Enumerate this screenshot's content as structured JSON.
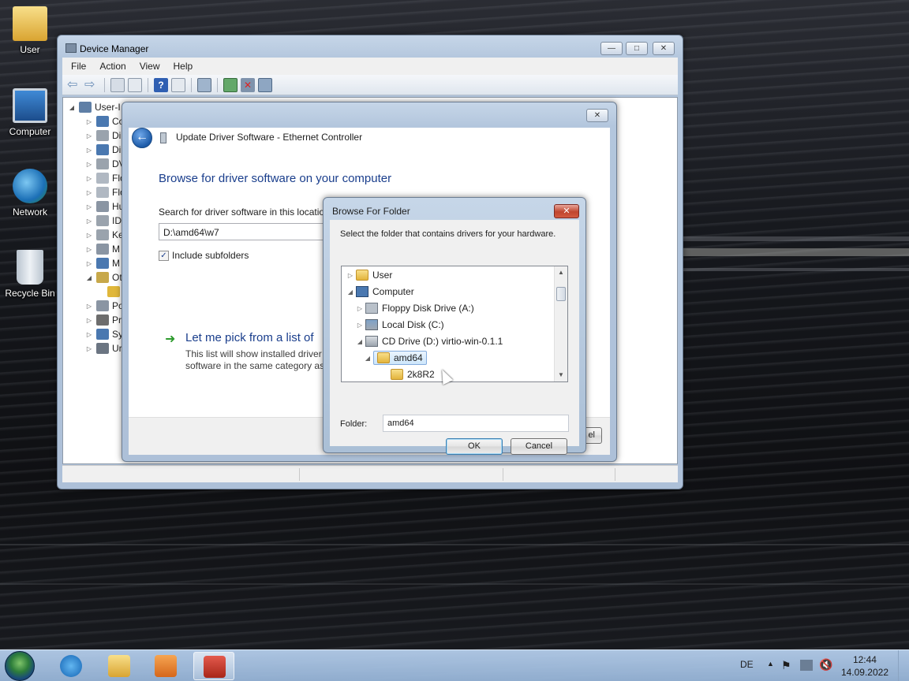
{
  "desktop": {
    "icons": [
      {
        "label": "User",
        "icon": "user-folder-icon"
      },
      {
        "label": "Computer",
        "icon": "computer-icon"
      },
      {
        "label": "Network",
        "icon": "network-icon"
      },
      {
        "label": "Recycle Bin",
        "icon": "recycle-bin-icon"
      }
    ]
  },
  "device_manager": {
    "title": "Device Manager",
    "menu": [
      "File",
      "Action",
      "View",
      "Help"
    ],
    "tree": {
      "root": "User-I",
      "items": [
        "Co",
        "Di",
        "Di",
        "DV",
        "Flo",
        "Flo",
        "Hu",
        "ID",
        "Ke",
        "M",
        "M",
        "Ot",
        "Po",
        "Pr",
        "Sy",
        "Ur"
      ]
    }
  },
  "wizard": {
    "title": "Update Driver Software - Ethernet Controller",
    "heading": "Browse for driver software on your computer",
    "search_label": "Search for driver software in this locatio",
    "path_value": "D:\\amd64\\w7",
    "include_subfolders": "Include subfolders",
    "pick_link": "Let me pick from a list of",
    "pick_desc_line1": "This list will show installed driver",
    "pick_desc_line2": "software in the same category as t",
    "cancel_partial": "el"
  },
  "browse": {
    "title": "Browse For Folder",
    "description": "Select the folder that contains drivers for your hardware.",
    "tree": [
      {
        "label": "User",
        "expanded": false
      },
      {
        "label": "Computer",
        "expanded": true
      },
      {
        "label": "Floppy Disk Drive (A:)",
        "expanded": false
      },
      {
        "label": "Local Disk (C:)",
        "expanded": false
      },
      {
        "label": "CD Drive (D:) virtio-win-0.1.1",
        "expanded": true
      },
      {
        "label": "amd64",
        "expanded": true,
        "selected": true
      },
      {
        "label": "2k8R2",
        "expanded": false
      }
    ],
    "folder_label": "Folder:",
    "folder_value": "amd64",
    "ok": "OK",
    "cancel": "Cancel"
  },
  "taskbar": {
    "language": "DE",
    "time": "12:44",
    "date": "14.09.2022"
  },
  "colors": {
    "link_blue": "#1a3e8c",
    "close_red": "#c0452e",
    "taskbar": "#a6c2e2"
  }
}
